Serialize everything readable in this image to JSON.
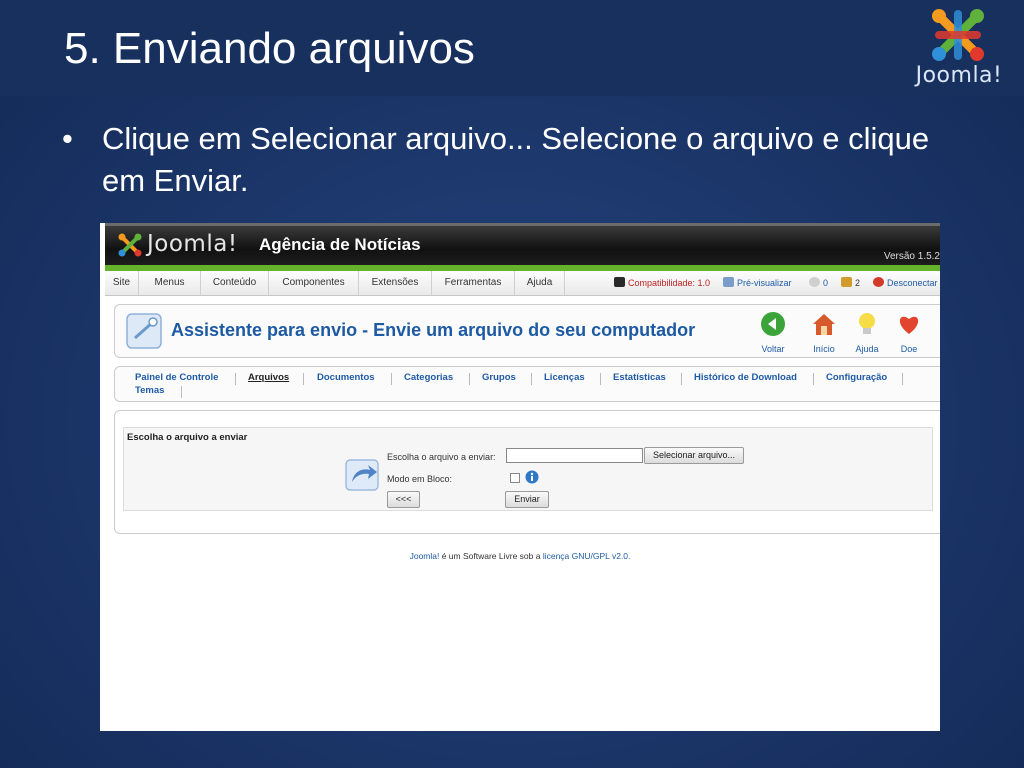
{
  "slide": {
    "title": "5. Enviando arquivos",
    "brand": "Joomla!",
    "bullet": "Clique em Selecionar arquivo... Selecione o arquivo e clique em Enviar.",
    "bullet_marker": "•"
  },
  "joomla": {
    "brand": "Joomla!",
    "site_name": "Agência de Notícias",
    "version": "Versão 1.5.2",
    "menu": [
      "Site",
      "Menus",
      "Conteúdo",
      "Componentes",
      "Extensões",
      "Ferramentas",
      "Ajuda"
    ],
    "status": {
      "compat": "Compatibilidade: 1.0",
      "preview": "Pré-visualizar",
      "messages": "0",
      "users": "2",
      "logout": "Desconectar"
    },
    "page_title": "Assistente para envio - Envie um arquivo do seu computador",
    "toolbar": [
      "Voltar",
      "Início",
      "Ajuda",
      "Doe"
    ],
    "subnav": [
      "Painel de Controle",
      "Arquivos",
      "Documentos",
      "Categorias",
      "Grupos",
      "Licenças",
      "Estatísticas",
      "Histórico de Download",
      "Configuração",
      "Temas"
    ],
    "form": {
      "legend": "Escolha o arquivo a enviar",
      "file_label": "Escolha o arquivo a enviar:",
      "file_value": "",
      "select_button": "Selecionar arquivo...",
      "batch_label": "Modo em Bloco:",
      "back_button": "<<<",
      "submit_button": "Enviar"
    },
    "footer": {
      "brand": "Joomla!",
      "text": " é um Software Livre sob a ",
      "license": "licença GNU/GPL v2.0."
    },
    "colors": {
      "accent_blue": "#1d5aa3",
      "green_bar": "#64b32a",
      "top_bar": "#111111"
    }
  }
}
